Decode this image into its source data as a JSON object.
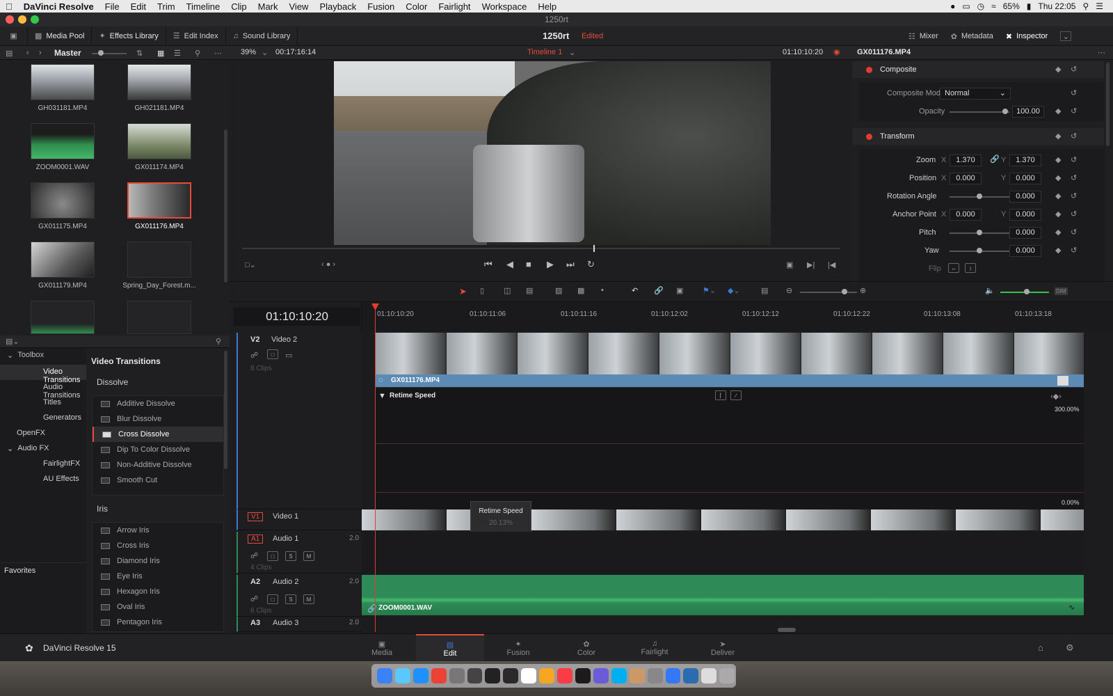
{
  "menubar": {
    "apple": "",
    "app": "DaVinci Resolve",
    "items": [
      "File",
      "Edit",
      "Trim",
      "Timeline",
      "Clip",
      "Mark",
      "View",
      "Playback",
      "Fusion",
      "Color",
      "Fairlight",
      "Workspace",
      "Help"
    ],
    "battery": "65%",
    "clock": "Thu 22:05"
  },
  "window": {
    "title": "1250rt"
  },
  "toolbar": {
    "media_pool": "Media Pool",
    "effects_library": "Effects Library",
    "edit_index": "Edit Index",
    "sound_library": "Sound Library",
    "project": "1250rt",
    "status": "Edited",
    "mixer": "Mixer",
    "metadata": "Metadata",
    "inspector": "Inspector"
  },
  "mediapool": {
    "bin": "Master",
    "clips": [
      {
        "name": "GH031181.MP4",
        "selected": false,
        "kind": "video"
      },
      {
        "name": "GH021181.MP4",
        "selected": false,
        "kind": "video"
      },
      {
        "name": "ZOOM0001.WAV",
        "selected": false,
        "kind": "audio"
      },
      {
        "name": "GX011174.MP4",
        "selected": false,
        "kind": "video"
      },
      {
        "name": "GX011175.MP4",
        "selected": false,
        "kind": "video"
      },
      {
        "name": "GX011176.MP4",
        "selected": true,
        "kind": "video"
      },
      {
        "name": "GX011179.MP4",
        "selected": false,
        "kind": "video"
      },
      {
        "name": "Spring_Day_Forest.m...",
        "selected": false,
        "kind": "empty"
      }
    ]
  },
  "viewer": {
    "zoom": "39%",
    "duration": "00:17:16:14",
    "timeline_name": "Timeline 1",
    "timecode": "01:10:10:20"
  },
  "inspector": {
    "clip": "GX011176.MP4",
    "composite_title": "Composite",
    "composite_mode_label": "Composite Mode",
    "composite_mode": "Normal",
    "opacity_label": "Opacity",
    "opacity": "100.00",
    "transform_title": "Transform",
    "zoom_label": "Zoom",
    "zoom_x": "1.370",
    "zoom_y": "1.370",
    "position_label": "Position",
    "pos_x": "0.000",
    "pos_y": "0.000",
    "rotation_label": "Rotation Angle",
    "rotation": "0.000",
    "anchor_label": "Anchor Point",
    "anchor_x": "0.000",
    "anchor_y": "0.000",
    "pitch_label": "Pitch",
    "pitch": "0.000",
    "yaw_label": "Yaw",
    "yaw": "0.000",
    "flip_label": "Flip",
    "x": "X",
    "y": "Y"
  },
  "effects": {
    "toolbox": "Toolbox",
    "tree": [
      {
        "label": "Video Transitions",
        "selected": true
      },
      {
        "label": "Audio Transitions",
        "selected": false
      },
      {
        "label": "Titles",
        "selected": false
      },
      {
        "label": "Generators",
        "selected": false
      }
    ],
    "openfx": "OpenFX",
    "audiofx": "Audio FX",
    "fairlightfx": "FairlightFX",
    "aueffects": "AU Effects",
    "favorites": "Favorites",
    "section_title": "Video Transitions",
    "dissolve_header": "Dissolve",
    "dissolve": [
      "Additive Dissolve",
      "Blur Dissolve",
      "Cross Dissolve",
      "Dip To Color Dissolve",
      "Non-Additive Dissolve",
      "Smooth Cut"
    ],
    "iris_header": "Iris",
    "iris": [
      "Arrow Iris",
      "Cross Iris",
      "Diamond Iris",
      "Eye Iris",
      "Hexagon Iris",
      "Oval Iris",
      "Pentagon Iris"
    ],
    "selected_effect": "Cross Dissolve"
  },
  "timeline": {
    "timecode": "01:10:10:20",
    "ruler": [
      "01:10:10:20",
      "01:10:11:06",
      "01:10:11:16",
      "01:10:12:02",
      "01:10:12:12",
      "01:10:12:22",
      "01:10:13:08",
      "01:10:13:18"
    ],
    "tracks": {
      "v2": {
        "id": "V2",
        "name": "Video 2",
        "clips": "8 Clips"
      },
      "v1": {
        "id": "V1",
        "name": "Video 1"
      },
      "a1": {
        "id": "A1",
        "name": "Audio 1",
        "level": "2.0",
        "clips": "4 Clips"
      },
      "a2": {
        "id": "A2",
        "name": "Audio 2",
        "level": "2.0",
        "clips": "6 Clips"
      },
      "a3": {
        "id": "A3",
        "name": "Audio 3",
        "level": "2.0"
      }
    },
    "clip_v2": "GX011176.MP4",
    "retime": "Retime Speed",
    "retime_max": "300.00%",
    "retime_min": "0.00%",
    "tooltip_title": "Retime Speed",
    "tooltip_value": "20.13%",
    "audio_clip": "ZOOM0001.WAV",
    "s": "S",
    "m": "M"
  },
  "pages": [
    "Media",
    "Edit",
    "Fusion",
    "Color",
    "Fairlight",
    "Deliver"
  ],
  "active_page": "Edit",
  "brand": "DaVinci Resolve 15",
  "colors": {
    "accent": "#e64b3b",
    "clip_blue": "#5b8ab5",
    "audio_green": "#2e8b57",
    "playhead": "#e03c31"
  }
}
